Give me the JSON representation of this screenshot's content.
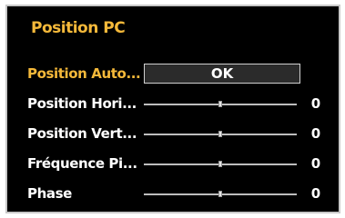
{
  "menu": {
    "title": "Position PC",
    "colors": {
      "accent": "#f5b93a",
      "background": "#000000",
      "text": "#ffffff"
    },
    "items": [
      {
        "label": "Position Auto...",
        "button_label": "OK"
      },
      {
        "label": "Position Hori...",
        "value": "0",
        "level": 0.5
      },
      {
        "label": "Position Vert...",
        "value": "0",
        "level": 0.5
      },
      {
        "label": "Fréquence Pi...",
        "value": "0",
        "level": 0.5
      },
      {
        "label": "Phase",
        "value": "0",
        "level": 0.5
      }
    ]
  }
}
